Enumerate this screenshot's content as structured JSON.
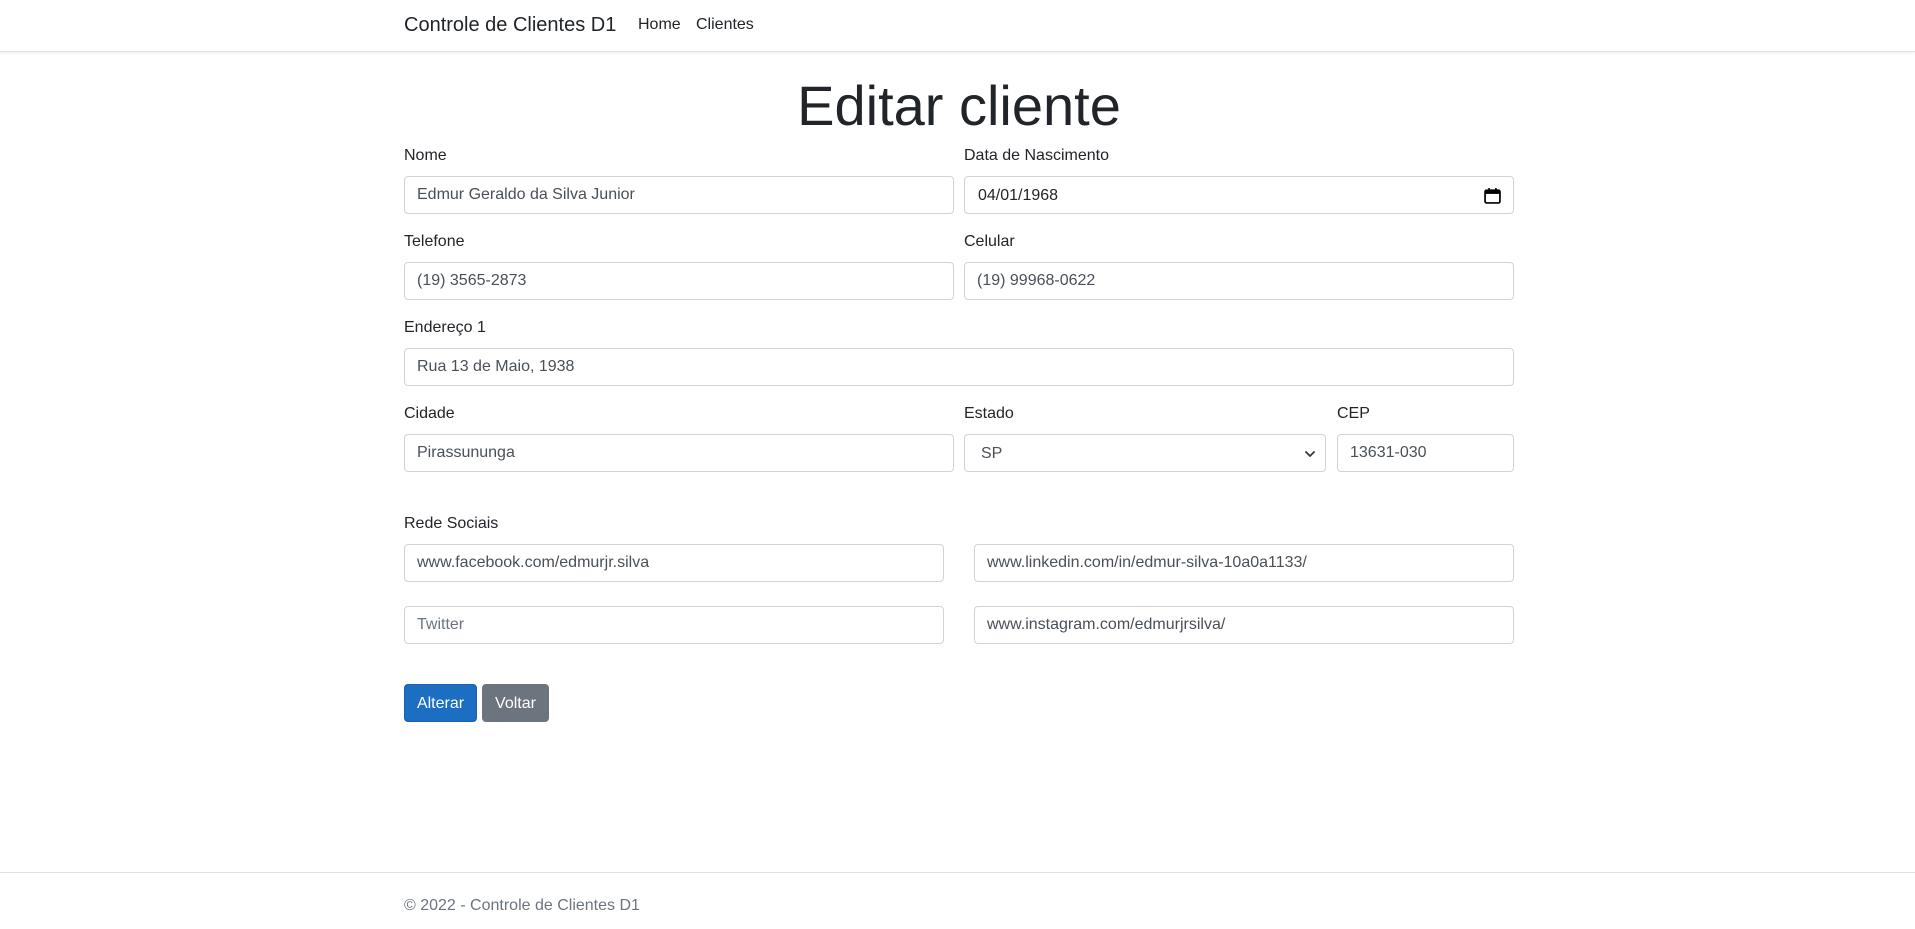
{
  "navbar": {
    "brand": "Controle de Clientes D1",
    "links": [
      "Home",
      "Clientes"
    ]
  },
  "page": {
    "title": "Editar cliente"
  },
  "form": {
    "nome": {
      "label": "Nome",
      "value": "Edmur Geraldo da Silva Junior"
    },
    "nascimento": {
      "label": "Data de Nascimento",
      "value": "04/01/1968"
    },
    "telefone": {
      "label": "Telefone",
      "value": "(19) 3565-2873"
    },
    "celular": {
      "label": "Celular",
      "value": "(19) 99968-0622"
    },
    "endereco": {
      "label": "Endereço 1",
      "value": "Rua 13 de Maio, 1938"
    },
    "cidade": {
      "label": "Cidade",
      "value": "Pirassununga"
    },
    "estado": {
      "label": "Estado",
      "value": "SP"
    },
    "cep": {
      "label": "CEP",
      "value": "13631-030"
    },
    "redes_label": "Rede Sociais",
    "facebook": {
      "value": "www.facebook.com/edmurjr.silva"
    },
    "linkedin": {
      "value": "www.linkedin.com/in/edmur-silva-10a0a1133/"
    },
    "twitter": {
      "value": "",
      "placeholder": "Twitter"
    },
    "instagram": {
      "value": "www.instagram.com/edmurjrsilva/"
    }
  },
  "buttons": {
    "alterar": "Alterar",
    "voltar": "Voltar"
  },
  "footer": {
    "text": "© 2022 - Controle de Clientes D1"
  },
  "colors": {
    "primary_button": "#1b6ec2",
    "secondary_button": "#6c757d",
    "border": "#ced4da"
  },
  "icons": {
    "date_picker": "calendar-icon",
    "select_dropdown": "chevron-down-icon"
  }
}
